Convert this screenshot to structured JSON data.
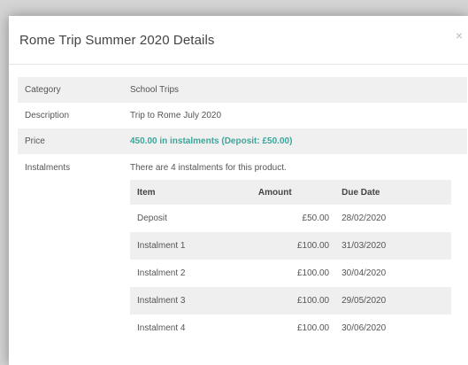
{
  "modal": {
    "title": "Rome Trip Summer 2020 Details",
    "close_label": "×"
  },
  "details": {
    "category": {
      "label": "Category",
      "value": "School Trips"
    },
    "description": {
      "label": "Description",
      "value": "Trip to Rome July 2020"
    },
    "price": {
      "label": "Price",
      "value": "450.00 in instalments (Deposit: £50.00)"
    },
    "instalments": {
      "label": "Instalments",
      "note": "There are 4 instalments for this product.",
      "headers": {
        "item": "Item",
        "amount": "Amount",
        "due": "Due Date"
      },
      "rows": [
        {
          "item": "Deposit",
          "amount": "£50.00",
          "due": "28/02/2020"
        },
        {
          "item": "Instalment 1",
          "amount": "£100.00",
          "due": "31/03/2020"
        },
        {
          "item": "Instalment 2",
          "amount": "£100.00",
          "due": "30/04/2020"
        },
        {
          "item": "Instalment 3",
          "amount": "£100.00",
          "due": "29/05/2020"
        },
        {
          "item": "Instalment 4",
          "amount": "£100.00",
          "due": "30/06/2020"
        }
      ]
    }
  },
  "colors": {
    "price_accent": "#3aa69b",
    "row_shade": "#f0f0f0"
  }
}
